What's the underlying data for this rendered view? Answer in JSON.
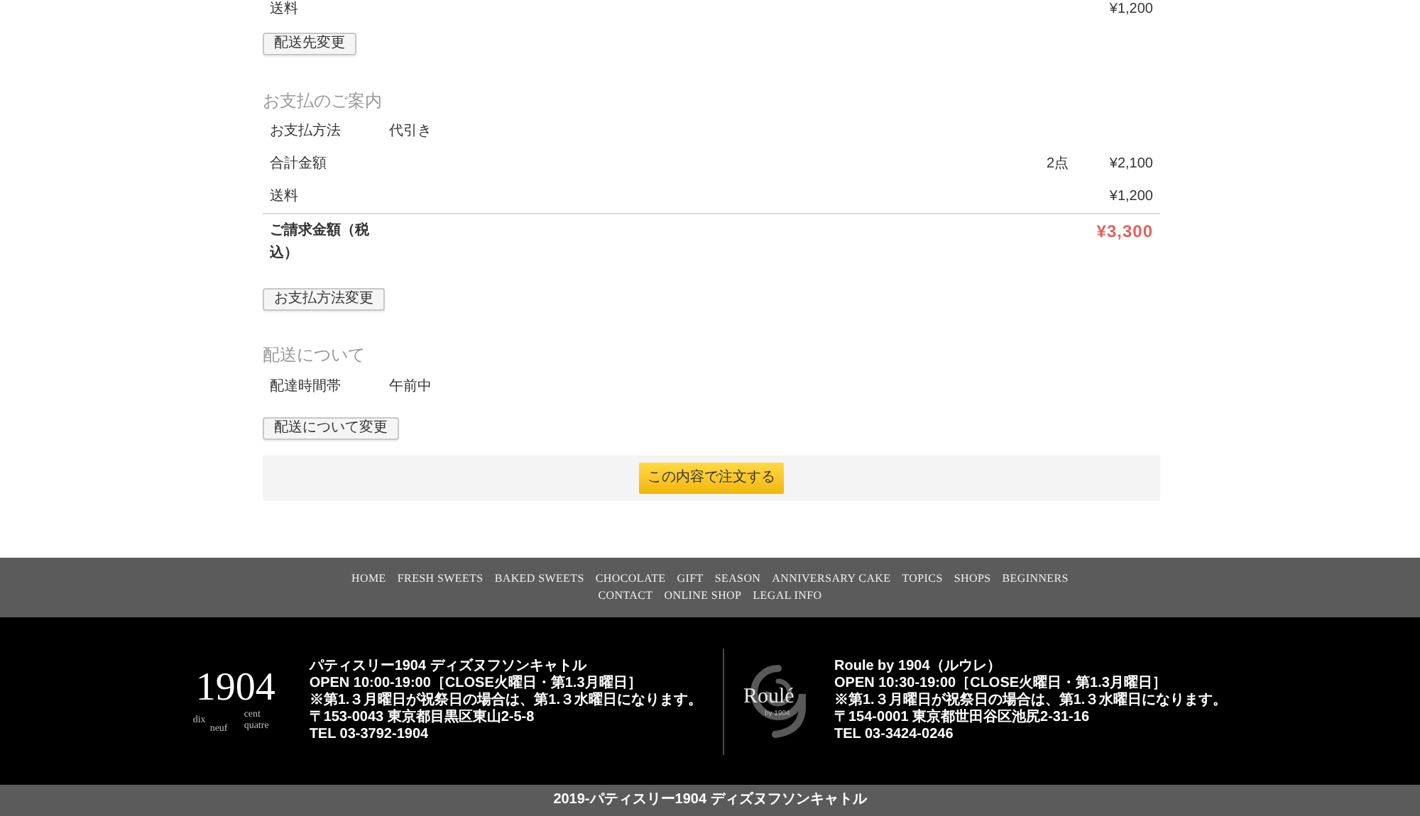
{
  "shipping_section": {
    "rows": [
      {
        "kind": "item",
        "label": "送料",
        "amount": "¥1,200"
      }
    ],
    "change_button": "配送先変更"
  },
  "payment_section": {
    "heading": "お支払のご案内",
    "rows": [
      {
        "kind": "item",
        "label": "お支払方法",
        "value": "代引き"
      },
      {
        "kind": "item",
        "label": "合計金額",
        "quantity": "2点",
        "amount": "¥2,100"
      },
      {
        "kind": "item",
        "label": "送料",
        "amount": "¥1,200"
      },
      {
        "kind": "total",
        "label": "ご請求金額（税込）",
        "amount": "¥3,300"
      }
    ],
    "change_button": "お支払方法変更"
  },
  "delivery_section": {
    "heading": "配送について",
    "rows": [
      {
        "kind": "item",
        "label": "配達時間帯",
        "value": "午前中"
      }
    ],
    "change_button": "配送について変更"
  },
  "order_button": "この内容で注文する",
  "footer_nav": [
    "HOME",
    "FRESH SWEETS",
    "BAKED SWEETS",
    "CHOCOLATE",
    "GIFT",
    "SEASON",
    "ANNIVERSARY CAKE",
    "TOPICS",
    "SHOPS",
    "BEGINNERS",
    "CONTACT",
    "ONLINE SHOP",
    "LEGAL INFO"
  ],
  "shops": [
    {
      "logo": {
        "kind": "numeral",
        "text": "1904",
        "words": [
          "dix",
          "cent",
          "neuf",
          "quatre"
        ]
      },
      "lines": [
        "パティスリー1904 ディズヌフソンキャトル",
        "OPEN 10:00-19:00［CLOSE火曜日・第1.3月曜日］",
        "※第1.３月曜日が祝祭日の場合は、第1.３水曜日になります。",
        "〒153-0043 東京都目黒区東山2-5-8",
        "TEL 03-3792-1904"
      ]
    },
    {
      "logo": {
        "kind": "swirl",
        "text": "Roulé",
        "subtext": "by 1904"
      },
      "lines": [
        "Roule by 1904（ルウレ）",
        "OPEN 10:30-19:00［CLOSE火曜日・第1.3月曜日］",
        "※第1.３月曜日が祝祭日の場合は、第1.３水曜日になります。",
        "〒154-0001 東京都世田谷区池尻2-31-16",
        "TEL 03-3424-0246"
      ]
    }
  ],
  "copyright": "2019-パティスリー1904 ディズヌフソンキャトル"
}
